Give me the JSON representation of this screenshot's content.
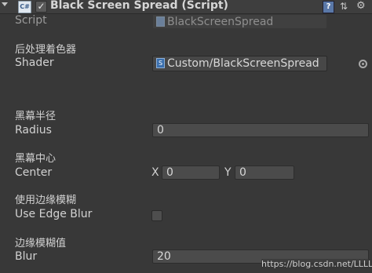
{
  "header": {
    "title": "Black Screen Spread (Script)",
    "script_icon_text": "C#",
    "enabled_mark": "✓",
    "icons": [
      "help-icon",
      "preset-icon",
      "gear-icon"
    ]
  },
  "script_row": {
    "label": "Script",
    "value": "BlackScreenSpread"
  },
  "section_postprocess": {
    "header": "后处理着色器",
    "label": "Shader",
    "value": "Custom/BlackScreenSpread",
    "icon_text": "S"
  },
  "section_radius": {
    "header": "黑幕半径",
    "label": "Radius",
    "value": "0"
  },
  "section_center": {
    "header": "黑幕中心",
    "label": "Center",
    "x_label": "X",
    "x_value": "0",
    "y_label": "Y",
    "y_value": "0"
  },
  "section_edge": {
    "header": "使用边缘模糊",
    "label": "Use Edge Blur",
    "checked": false
  },
  "section_blur": {
    "header": "边缘模糊值",
    "label": "Blur",
    "value": "20"
  },
  "watermark": "https://blog.csdn.net/LLLLL__"
}
